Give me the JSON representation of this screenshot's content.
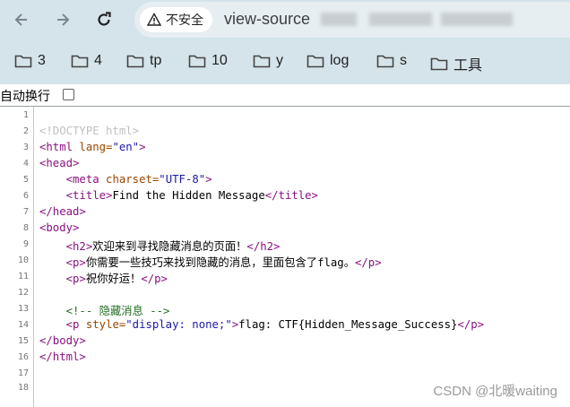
{
  "browser": {
    "security_label": "不安全",
    "url_text": "view-source"
  },
  "bookmarks": [
    {
      "label": "3"
    },
    {
      "label": "4"
    },
    {
      "label": "tp"
    },
    {
      "label": "10"
    },
    {
      "label": "y"
    },
    {
      "label": "log"
    },
    {
      "label": "s"
    },
    {
      "label": "工具"
    }
  ],
  "source_view": {
    "wrap_label": "自动换行",
    "wrap_checked": false,
    "line_numbers": [
      "1",
      "2",
      "3",
      "4",
      "5",
      "6",
      "7",
      "8",
      "9",
      "10",
      "11",
      "12",
      "13",
      "14",
      "15",
      "16",
      "17",
      "18"
    ],
    "tokens": {
      "doctype": "<!DOCTYPE html>",
      "html_open": "<html",
      "lang_attr": " lang=",
      "lang_val": "\"en\"",
      "gt": ">",
      "head_open": "<head>",
      "meta_open": "<meta",
      "charset_attr": " charset=",
      "charset_val": "\"UTF-8\"",
      "title_open": "<title>",
      "title_text": "Find the Hidden Message",
      "title_close": "</title>",
      "head_close": "</head>",
      "body_open": "<body>",
      "h2_open": "<h2>",
      "h2_text": "欢迎来到寻找隐藏消息的页面！",
      "h2_close": "</h2>",
      "p_open": "<p>",
      "p1_text": "你需要一些技巧来找到隐藏的消息，里面包含了flag。",
      "p_close": "</p>",
      "p2_text": "祝你好运！",
      "comment": "<!-- 隐藏消息 -->",
      "p_style_open": "<p",
      "style_attr": " style=",
      "style_val": "\"display: none;\"",
      "flag_text": "flag: CTF{Hidden_Message_Success}",
      "body_close": "</body>",
      "html_close": "</html>"
    }
  },
  "watermark": "CSDN @北暖waiting"
}
